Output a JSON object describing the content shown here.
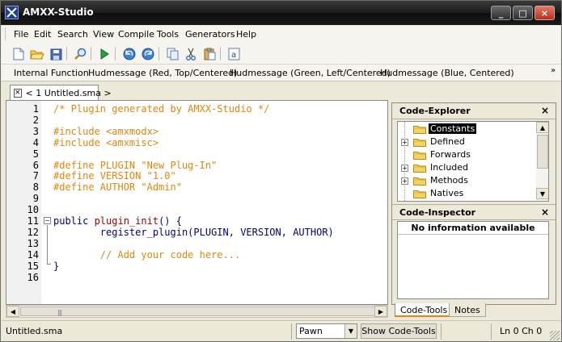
{
  "window": {
    "title": "AMXX-Studio",
    "controls": {
      "minimize": "_",
      "maximize": "□",
      "close": "×"
    }
  },
  "menu": [
    "File",
    "Edit",
    "Search",
    "View",
    "Compile",
    "Tools",
    "Generators",
    "Help"
  ],
  "toolbar": {
    "icons": [
      "new-file-icon",
      "open-folder-icon",
      "save-icon",
      "search-icon",
      "compile-run-icon",
      "undo-icon",
      "redo-icon",
      "copy-icon",
      "cut-icon",
      "paste-icon",
      "select-all-icon"
    ]
  },
  "function_bar": {
    "items": [
      "Internal Function",
      "Hudmessage (Red, Top/Centered)",
      "Hudmessage (Green, Left/Centered)",
      "Hudmessage (Blue, Centered)"
    ],
    "more": "»"
  },
  "document_tab": {
    "label": "< 1 Untitled.sma >",
    "close": "×"
  },
  "editor": {
    "lines": [
      {
        "n": "1",
        "text": "/* Plugin generated by AMXX-Studio */",
        "kind": "comment"
      },
      {
        "n": "2",
        "text": "",
        "kind": "plain"
      },
      {
        "n": "3",
        "text": "#include <amxmodx>",
        "kind": "pre"
      },
      {
        "n": "4",
        "text": "#include <amxmisc>",
        "kind": "pre"
      },
      {
        "n": "5",
        "text": "",
        "kind": "plain"
      },
      {
        "n": "6",
        "text": "#define PLUGIN \"New Plug-In\"",
        "kind": "pre"
      },
      {
        "n": "7",
        "text": "#define VERSION \"1.0\"",
        "kind": "pre"
      },
      {
        "n": "8",
        "text": "#define AUTHOR \"Admin\"",
        "kind": "pre"
      },
      {
        "n": "9",
        "text": "",
        "kind": "plain"
      },
      {
        "n": "10",
        "text": "",
        "kind": "plain"
      },
      {
        "n": "11",
        "text": "public plugin_init() {",
        "kind": "func"
      },
      {
        "n": "12",
        "text": "        register_plugin(PLUGIN, VERSION, AUTHOR)",
        "kind": "plain"
      },
      {
        "n": "13",
        "text": "",
        "kind": "plain"
      },
      {
        "n": "14",
        "text": "        // Add your code here...",
        "kind": "comment"
      },
      {
        "n": "15",
        "text": "}",
        "kind": "plain"
      },
      {
        "n": "16",
        "text": "",
        "kind": "plain"
      }
    ],
    "func_keyword": "public ",
    "func_name": "plugin_init",
    "func_rest": "() {"
  },
  "code_explorer": {
    "title": "Code-Explorer",
    "close": "×",
    "items": [
      {
        "label": "Constants",
        "expandable": false,
        "selected": true
      },
      {
        "label": "Defined",
        "expandable": true,
        "selected": false
      },
      {
        "label": "Forwards",
        "expandable": false,
        "selected": false
      },
      {
        "label": "Included",
        "expandable": true,
        "selected": false
      },
      {
        "label": "Methods",
        "expandable": true,
        "selected": false
      },
      {
        "label": "Natives",
        "expandable": false,
        "selected": false
      }
    ]
  },
  "code_inspector": {
    "title": "Code-Inspector",
    "close": "×",
    "message": "No information available"
  },
  "panel_tabs": {
    "active": "Code-Tools",
    "inactive": "Notes"
  },
  "statusbar": {
    "file": "Untitled.sma",
    "language": "Pawn",
    "show_tools": "Show Code-Tools",
    "position": "Ln 0 Ch 0"
  },
  "colors": {
    "comment": "#e2860d",
    "keyword": "#000080",
    "function": "#a00000"
  }
}
